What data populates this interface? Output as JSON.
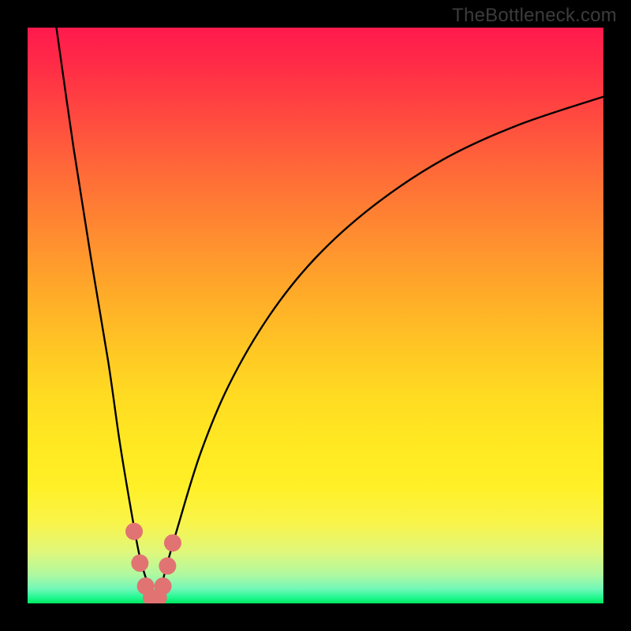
{
  "watermark": "TheBottleneck.com",
  "chart_data": {
    "type": "line",
    "title": "",
    "xlabel": "",
    "ylabel": "",
    "xlim": [
      0,
      100
    ],
    "ylim": [
      0,
      100
    ],
    "grid": false,
    "legend": false,
    "series": [
      {
        "name": "bottleneck-curve",
        "x": [
          5,
          8,
          11,
          14,
          16,
          18,
          19.5,
          21,
          22,
          23,
          24,
          26,
          30,
          35,
          42,
          50,
          60,
          72,
          85,
          100
        ],
        "values": [
          100,
          79,
          60,
          42,
          28,
          16,
          8,
          3,
          0,
          2,
          6,
          13,
          26,
          38,
          50,
          60,
          69,
          77,
          83,
          88
        ]
      },
      {
        "name": "marker-dots",
        "x": [
          18.5,
          19.5,
          20.5,
          21.5,
          22.7,
          23.5,
          24.3,
          25.2
        ],
        "values": [
          12.5,
          7.0,
          3.0,
          1.0,
          1.0,
          3.0,
          6.5,
          10.5
        ]
      }
    ],
    "colors": {
      "curve": "#000000",
      "dots": "#e17373",
      "gradient_top": "#ff1a4d",
      "gradient_bottom": "#00e860"
    }
  }
}
